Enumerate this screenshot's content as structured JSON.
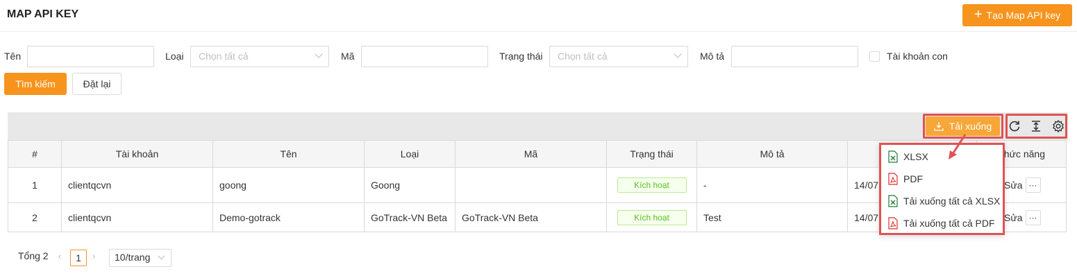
{
  "header": {
    "title": "MAP API KEY",
    "create_label": "Tạo Map API key"
  },
  "filters": {
    "name_label": "Tên",
    "type_label": "Loại",
    "type_placeholder": "Chọn tất cả",
    "code_label": "Mã",
    "status_label": "Trạng thái",
    "status_placeholder": "Chọn tất cả",
    "desc_label": "Mô tả",
    "subaccount_label": "Tài khoản con",
    "search_label": "Tìm kiếm",
    "reset_label": "Đặt lại"
  },
  "toolbar": {
    "download_label": "Tải xuống"
  },
  "table": {
    "columns": [
      "#",
      "Tài khoản",
      "Tên",
      "Loại",
      "Mã",
      "Trạng thái",
      "Mô tả",
      "",
      "hức năng"
    ],
    "rows": [
      {
        "no": "1",
        "account": "clientqcvn",
        "name": "goong",
        "type": "Goong",
        "code": "",
        "status": "Kích hoạt",
        "desc": "-",
        "date": "14/07",
        "edit": "Sửa",
        "more": "···"
      },
      {
        "no": "2",
        "account": "clientqcvn",
        "name": "Demo-gotrack",
        "type": "GoTrack-VN Beta",
        "code": "GoTrack-VN Beta",
        "status": "Kích hoạt",
        "desc": "Test",
        "date": "14/07",
        "edit": "Sửa",
        "more": "···"
      }
    ]
  },
  "dropdown": {
    "items": [
      {
        "label": "XLSX",
        "icon": "excel-file-icon"
      },
      {
        "label": "PDF",
        "icon": "pdf-file-icon"
      },
      {
        "label": "Tải xuống tất cả XLSX",
        "icon": "excel-file-icon"
      },
      {
        "label": "Tải xuống tất cả PDF",
        "icon": "pdf-file-icon"
      }
    ]
  },
  "pagination": {
    "total": "Tổng 2",
    "current_page": "1",
    "page_size": "10/trang"
  },
  "colors": {
    "accent": "#f7941d",
    "highlight": "#e05252",
    "success": "#52c41a",
    "excel": "#1d7a35",
    "pdf": "#e02b2b"
  }
}
